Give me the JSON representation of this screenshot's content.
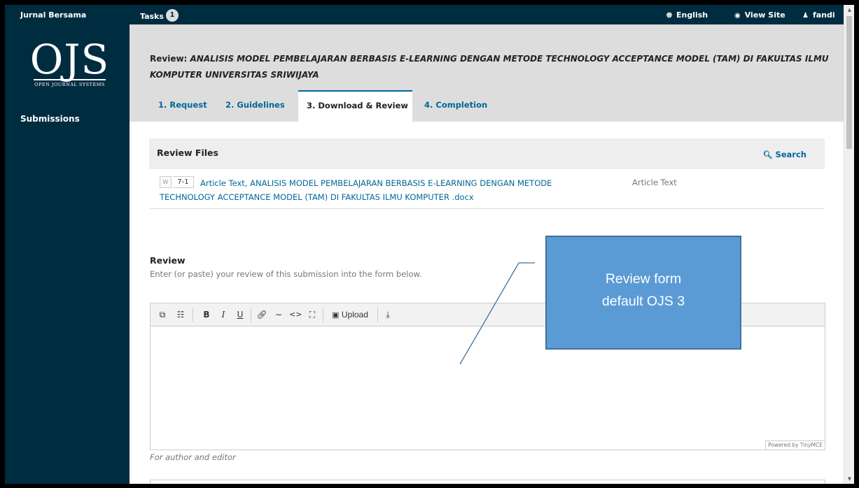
{
  "topbar": {
    "journal_name": "Jurnal Bersama",
    "tasks_label": "Tasks",
    "tasks_count": "1",
    "language": "English",
    "view_site": "View Site",
    "user": "fandi"
  },
  "sidebar": {
    "logo_main": "OJS",
    "logo_sub": "OPEN JOURNAL SYSTEMS",
    "items": [
      {
        "label": "Submissions"
      }
    ]
  },
  "header": {
    "title_prefix": "Review: ",
    "title": "ANALISIS MODEL PEMBELAJARAN BERBASIS E-LEARNING DENGAN METODE TECHNOLOGY ACCEPTANCE MODEL (TAM) DI FAKULTAS ILMU KOMPUTER UNIVERSITAS SRIWIJAYA",
    "tabs": [
      {
        "label": "1. Request",
        "active": false
      },
      {
        "label": "2. Guidelines",
        "active": false
      },
      {
        "label": "3. Download & Review",
        "active": true
      },
      {
        "label": "4. Completion",
        "active": false
      }
    ]
  },
  "review_files": {
    "title": "Review Files",
    "search_label": "Search",
    "files": [
      {
        "id": "7-1",
        "name": "Article Text, ANALISIS MODEL PEMBELAJARAN BERBASIS E-LEARNING DENGAN METODE TECHNOLOGY ACCEPTANCE MODEL (TAM) DI FAKULTAS ILMU KOMPUTER .docx",
        "type": "Article Text"
      }
    ]
  },
  "review": {
    "label": "Review",
    "description": "Enter (or paste) your review of this submission into the form below.",
    "editor": {
      "toolbar": {
        "copy": "copy-icon",
        "paste": "paste-icon",
        "bold": "B",
        "italic": "I",
        "underline": "U",
        "link": "link-icon",
        "unlink": "unlink-icon",
        "code": "<>",
        "fullscreen": "fullscreen-icon",
        "upload_label": "Upload",
        "insert": "download-icon"
      },
      "value": "",
      "powered_by": "Powered by TinyMCE"
    },
    "footnote": "For author and editor"
  },
  "annotation": {
    "line1": "Review form",
    "line2": "default OJS 3"
  },
  "colors": {
    "navy": "#002c40",
    "link": "#006798",
    "header_bg": "#dddddd",
    "callout_fill": "#5b9bd5",
    "callout_border": "#41719c"
  }
}
